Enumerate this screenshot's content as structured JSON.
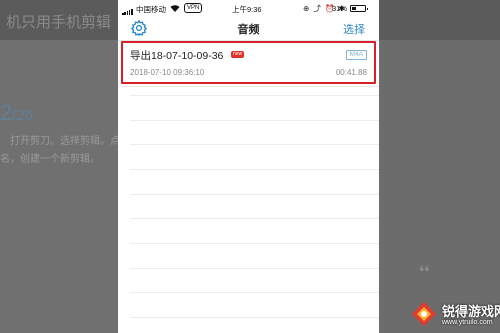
{
  "background": {
    "title_fragment": "机只用手机剪辑",
    "step_number": "2",
    "step_total": "/26",
    "line1": "打开剪刀。选择剪辑。点",
    "line2": "名，创建一个新剪辑。"
  },
  "statusbar": {
    "carrier": "中国移动",
    "vpn": "VPN",
    "time": "上午9:36",
    "icons": "⊕ ⤴ ⏰ ✱",
    "battery_pct": "31%",
    "battery_level": 0.31
  },
  "navbar": {
    "settings_icon": "gear-icon",
    "title": "音频",
    "select_label": "选择"
  },
  "recordings": [
    {
      "name": "导出18-07-10-09-36",
      "badge": "new",
      "format": "M4A",
      "date": "2018-07-10 09:36:10",
      "duration": "00:41.88",
      "highlighted": true
    }
  ],
  "watermark": {
    "name": "锐得游戏网",
    "url": "www.ytruilo.com"
  },
  "colors": {
    "accent": "#2c86c7",
    "highlight": "#d9202a",
    "badge_new": "#e0302a"
  }
}
